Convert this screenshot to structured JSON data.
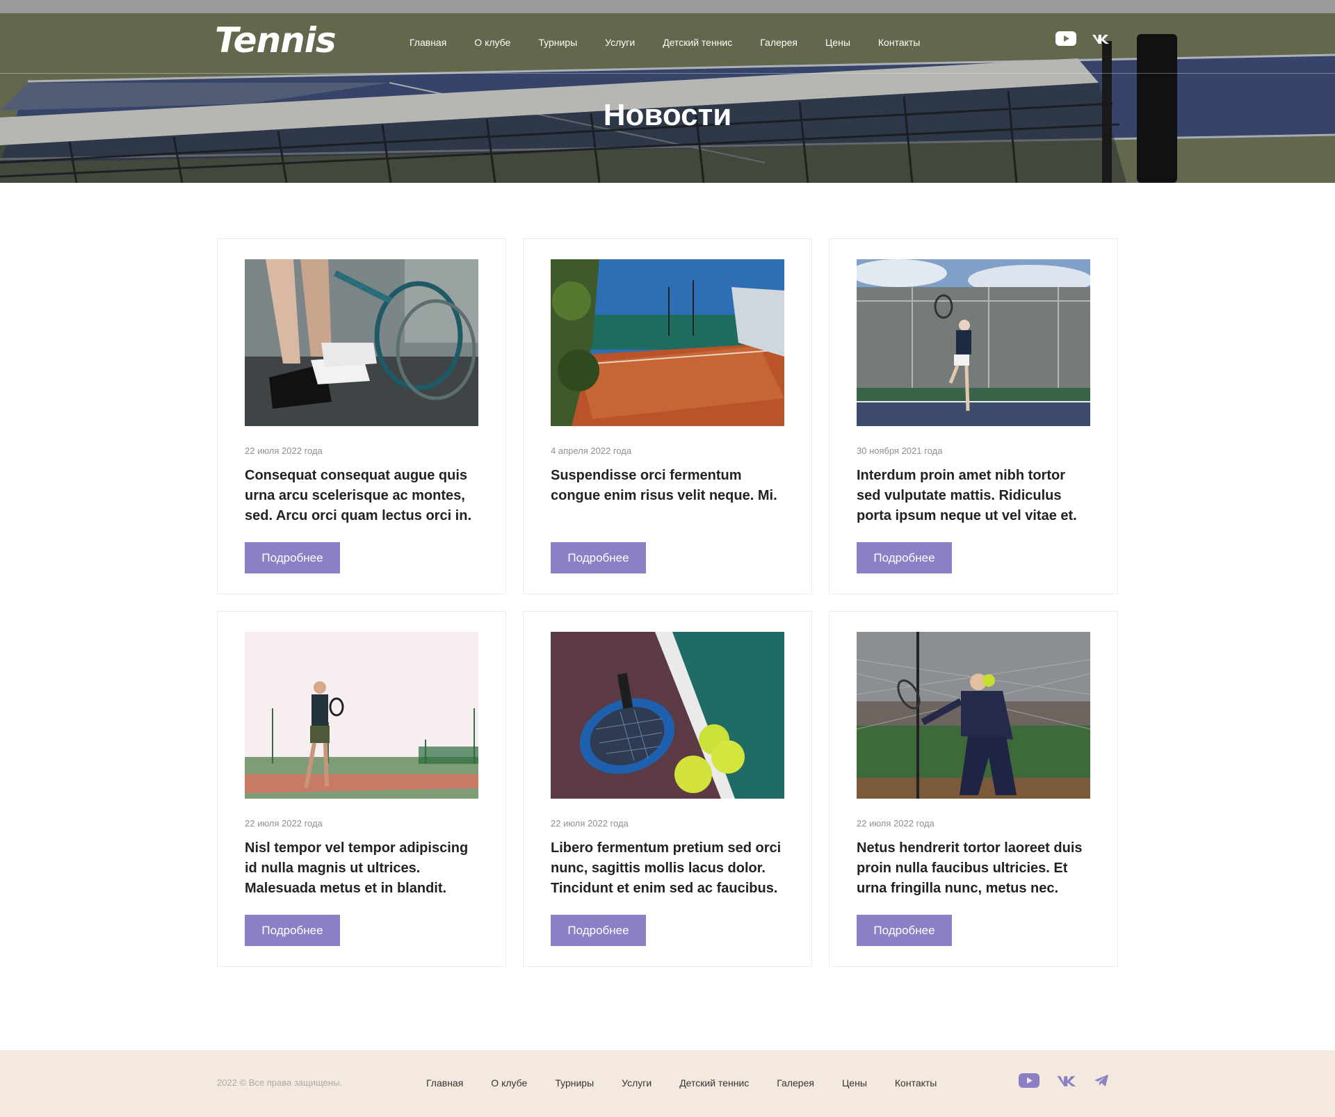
{
  "brand": {
    "logo": "Tennis"
  },
  "nav": [
    "Главная",
    "О клубе",
    "Турниры",
    "Услуги",
    "Детский теннис",
    "Галерея",
    "Цены",
    "Контакты"
  ],
  "social": [
    "youtube-icon",
    "vk-icon",
    "telegram-icon"
  ],
  "hero": {
    "title": "Новости"
  },
  "news": [
    {
      "date": "22 июля 2022 года",
      "title": "Consequat consequat augue quis urna arcu scelerisque ac montes, sed. Arcu orci quam lectus orci in.",
      "button": "Подробнее"
    },
    {
      "date": "4 апреля 2022 года",
      "title": "Suspendisse orci fermentum congue enim risus velit neque. Mi.",
      "button": "Подробнее"
    },
    {
      "date": "30 ноября 2021 года",
      "title": "Interdum proin amet nibh tortor sed vulputate mattis. Ridiculus porta ipsum neque ut vel vitae et.",
      "button": "Подробнее"
    },
    {
      "date": "22 июля 2022 года",
      "title": "Nisl tempor vel tempor adipiscing id nulla magnis ut ultrices. Malesuada metus et in blandit.",
      "button": "Подробнее"
    },
    {
      "date": "22 июля 2022 года",
      "title": "Libero fermentum pretium sed orci nunc, sagittis mollis lacus dolor. Tincidunt et enim sed ac faucibus.",
      "button": "Подробнее"
    },
    {
      "date": "22 июля 2022 года",
      "title": "Netus hendrerit tortor laoreet duis proin nulla faucibus ultricies. Et urna fringilla nunc, metus nec.",
      "button": "Подробнее"
    }
  ],
  "footer": {
    "copyright": "2022 © Все права защищены.",
    "nav": [
      "Главная",
      "О клубе",
      "Турниры",
      "Услуги",
      "Детский теннис",
      "Галерея",
      "Цены",
      "Контакты"
    ]
  },
  "colors": {
    "accent": "#8b80c6",
    "footer_bg": "#f4e9df",
    "header_overlay": "#6e7652"
  }
}
